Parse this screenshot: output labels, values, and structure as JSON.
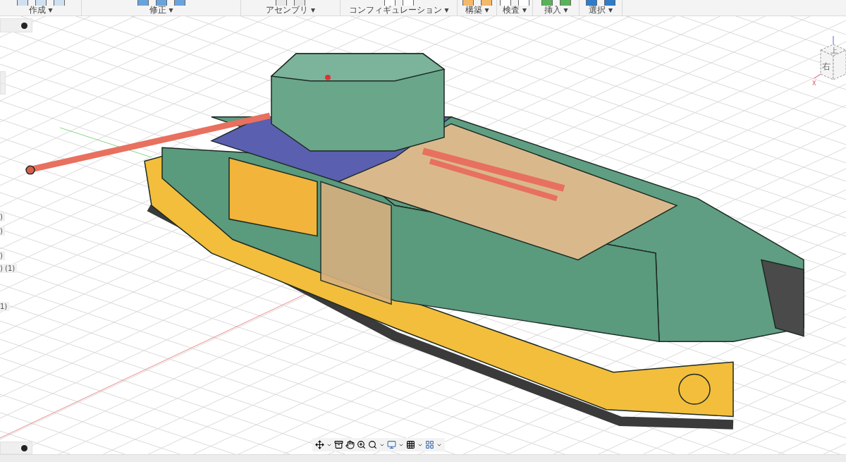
{
  "toolbar": {
    "groups": [
      {
        "label": "作成 ▾"
      },
      {
        "label": "修正 ▾"
      },
      {
        "label": "アセンブリ ▾"
      },
      {
        "label": "コンフィギュレーション ▾"
      },
      {
        "label": "構築 ▾"
      },
      {
        "label": "検査 ▾"
      },
      {
        "label": "挿入 ▾"
      },
      {
        "label": "選択 ▾"
      }
    ]
  },
  "browser_fragments": [
    ")",
    ")",
    ")",
    ") (1)",
    "1)"
  ],
  "view_cube": {
    "top": "上",
    "right": "右",
    "axis": "X"
  }
}
